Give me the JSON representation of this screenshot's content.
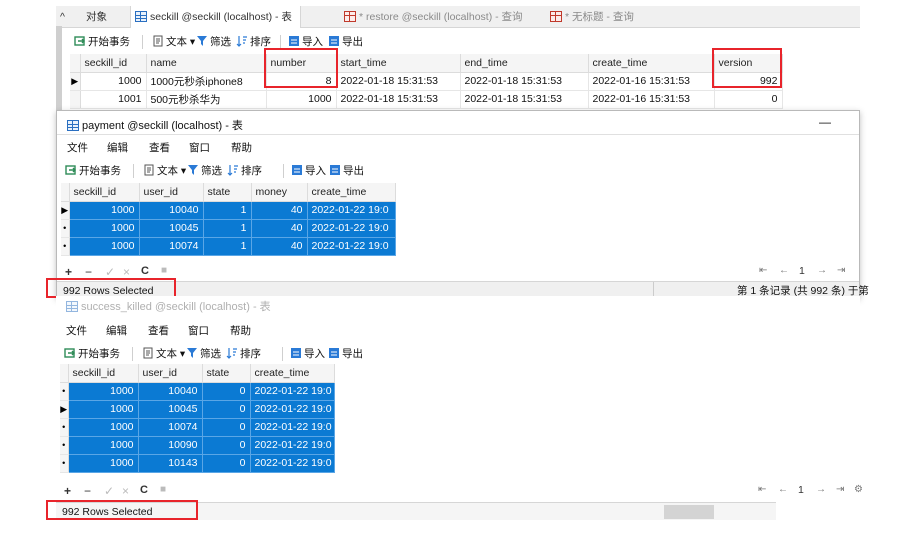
{
  "top_tabs": {
    "objects_label": "对象",
    "tab1": "seckill @seckill (localhost) - 表",
    "tab2": "* restore @seckill (localhost) - 查询",
    "tab3": "* 无标题 - 查询"
  },
  "toolbar": {
    "begin_tx": "开始事务",
    "text": "文本",
    "filter": "筛选",
    "sort": "排序",
    "import": "导入",
    "export": "导出"
  },
  "seckill_grid": {
    "columns": [
      "seckill_id",
      "name",
      "number",
      "start_time",
      "end_time",
      "create_time",
      "version"
    ],
    "rows": [
      [
        "1000",
        "1000元秒杀iphone8",
        "8",
        "2022-01-18 15:31:53",
        "2022-01-18 15:31:53",
        "2022-01-16 15:31:53",
        "992"
      ],
      [
        "1001",
        "500元秒杀华为",
        "1000",
        "2022-01-18 15:31:53",
        "2022-01-18 15:31:53",
        "2022-01-16 15:31:53",
        "0"
      ]
    ]
  },
  "payment_window": {
    "title": "payment @seckill (localhost) - 表",
    "minimize_glyph": "—",
    "menu": [
      "文件",
      "编辑",
      "查看",
      "窗口",
      "帮助"
    ],
    "columns": [
      "seckill_id",
      "user_id",
      "state",
      "money",
      "create_time"
    ],
    "rows": [
      [
        "1000",
        "10040",
        "1",
        "40",
        "2022-01-22 19:0"
      ],
      [
        "1000",
        "10045",
        "1",
        "40",
        "2022-01-22 19:0"
      ],
      [
        "1000",
        "10074",
        "1",
        "40",
        "2022-01-22 19:0"
      ]
    ],
    "status": "992 Rows Selected",
    "record_info": "第 1 条记录 (共 992 条) 于第",
    "page": "1"
  },
  "success_window": {
    "title": "success_killed @seckill (localhost) - 表",
    "menu": [
      "文件",
      "编辑",
      "查看",
      "窗口",
      "帮助"
    ],
    "columns": [
      "seckill_id",
      "user_id",
      "state",
      "create_time"
    ],
    "rows": [
      [
        "1000",
        "10040",
        "0",
        "2022-01-22 19:0"
      ],
      [
        "1000",
        "10045",
        "0",
        "2022-01-22 19:0"
      ],
      [
        "1000",
        "10074",
        "0",
        "2022-01-22 19:0"
      ],
      [
        "1000",
        "10090",
        "0",
        "2022-01-22 19:0"
      ],
      [
        "1000",
        "10143",
        "0",
        "2022-01-22 19:0"
      ]
    ],
    "status": "992 Rows Selected",
    "page": "1"
  },
  "colors": {
    "selection": "#0b7ad3",
    "highlight": "#e8242b",
    "toolbar_bg": "#f0f0f0"
  }
}
